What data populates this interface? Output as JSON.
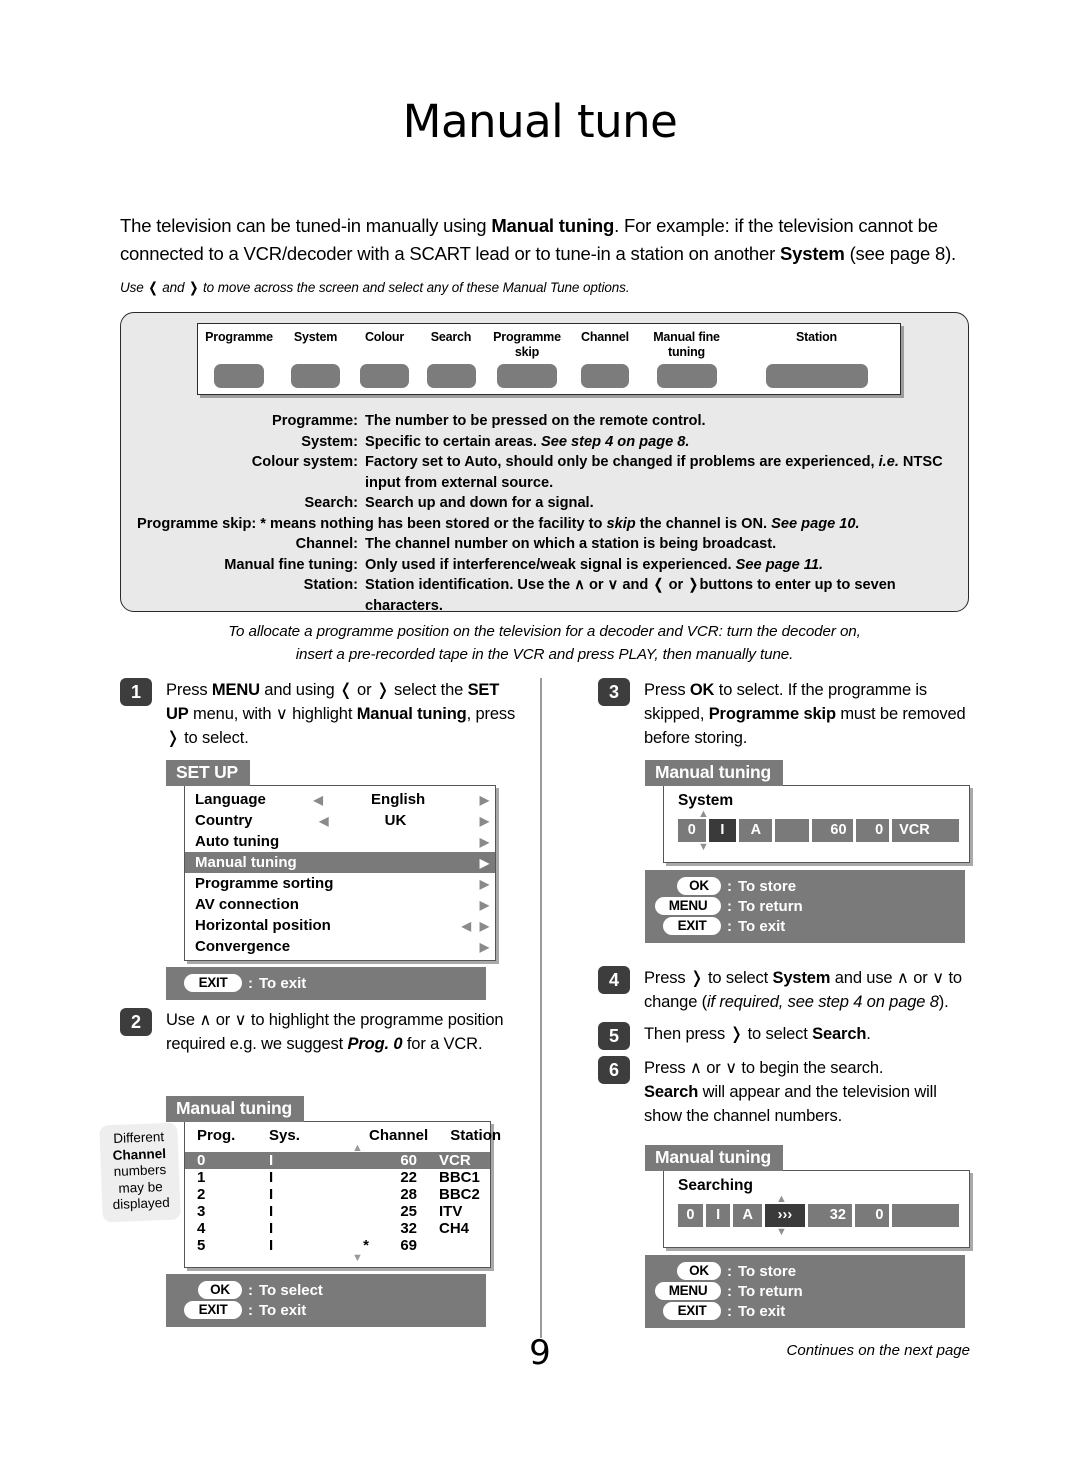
{
  "page": {
    "title": "Manual tune",
    "number": "9",
    "footer_note": "Continues on the next page"
  },
  "intro": {
    "line": "The television can be tuned-in manually using Manual tuning. For example: if the television cannot be connected to a VCR/decoder with a SCART lead or to tune-in a station on another System (see page 8).",
    "bold_1": "Manual tuning",
    "bold_2": "System",
    "use_note": "Use ‹ and › to move across the screen and select any of these Manual Tune options."
  },
  "option_bar": {
    "labels": [
      "Programme",
      "System",
      "Colour",
      "Search",
      "Programme\nskip",
      "Channel",
      "Manual fine\ntuning",
      "Station"
    ],
    "label_lines": [
      [
        "Programme",
        ""
      ],
      [
        "System",
        ""
      ],
      [
        "Colour",
        ""
      ],
      [
        "Search",
        ""
      ],
      [
        "Programme",
        "skip"
      ],
      [
        "Channel",
        ""
      ],
      [
        "Manual fine",
        "tuning"
      ],
      [
        "Station",
        ""
      ]
    ]
  },
  "definitions": [
    {
      "term": "Programme:",
      "desc": "The number to be pressed on the remote control."
    },
    {
      "term": "System:",
      "desc": "Specific to certain areas. See step 4 on page 8."
    },
    {
      "term": "Colour system:",
      "desc": "Factory set to Auto, should only be changed if problems are experienced, i.e. NTSC input from external source."
    },
    {
      "term": "Search:",
      "desc": "Search up and down for a signal."
    },
    {
      "term": "Programme skip:",
      "desc": "* means nothing has been stored or the facility to skip the channel is ON. See page 10."
    },
    {
      "term": "Channel:",
      "desc": "The channel number on which a station is being broadcast."
    },
    {
      "term": "Manual fine tuning:",
      "desc": "Only used if interference/weak signal is experienced. See page 11."
    },
    {
      "term": "Station:",
      "desc": "Station identification. Use the ∧ or ∨ and ‹ or › buttons to enter up to seven characters."
    }
  ],
  "allocate_note": {
    "line1": "To allocate a programme position on the television for a decoder and VCR: turn the decoder on,",
    "line2": "insert a pre-recorded tape in the VCR and press PLAY, then manually tune."
  },
  "steps": {
    "s1": {
      "num": "1",
      "text": "Press MENU and using ‹ or › select the SET UP menu, with ∨ highlight Manual tuning, press › to select."
    },
    "s2": {
      "num": "2",
      "text": "Use ∧ or ∨ to highlight the programme position required e.g. we suggest Prog. 0 for a VCR."
    },
    "s3": {
      "num": "3",
      "text": "Press OK to select. If the programme is skipped, Programme skip must be removed before storing."
    },
    "s4": {
      "num": "4",
      "text": "Press › to select System and use ∧ or ∨ to change (if required, see step 4 on page 8)."
    },
    "s5": {
      "num": "5",
      "text": "Then press › to select Search."
    },
    "s6": {
      "num": "6",
      "text": "Press ∧ or ∨ to begin the search. Search will appear and the television will show the channel numbers."
    }
  },
  "setup_menu": {
    "tab": "SET UP",
    "items": [
      {
        "label": "Language",
        "value": "English",
        "left_arrow": true,
        "right_arrow": true,
        "selected": false
      },
      {
        "label": "Country",
        "value": "UK",
        "left_arrow": true,
        "right_arrow": true,
        "selected": false
      },
      {
        "label": "Auto tuning",
        "value": "",
        "left_arrow": false,
        "right_arrow": true,
        "selected": false
      },
      {
        "label": "Manual tuning",
        "value": "",
        "left_arrow": false,
        "right_arrow": true,
        "selected": true
      },
      {
        "label": "Programme sorting",
        "value": "",
        "left_arrow": false,
        "right_arrow": true,
        "selected": false
      },
      {
        "label": "AV connection",
        "value": "",
        "left_arrow": false,
        "right_arrow": true,
        "selected": false
      },
      {
        "label": "Horizontal position",
        "value": "",
        "left_arrow": true,
        "right_arrow": true,
        "selected": false
      },
      {
        "label": "Convergence",
        "value": "",
        "left_arrow": false,
        "right_arrow": true,
        "selected": false
      }
    ],
    "footer": [
      {
        "key": "EXIT",
        "colon": ":",
        "action": "To exit"
      }
    ]
  },
  "manual_tuning_table": {
    "tab": "Manual tuning",
    "columns": [
      "Prog.",
      "Sys.",
      "Channel",
      "Station"
    ],
    "rows": [
      {
        "prog": "0",
        "sys": "I",
        "star": "",
        "channel": "60",
        "station": "VCR",
        "selected": true
      },
      {
        "prog": "1",
        "sys": "I",
        "star": "",
        "channel": "22",
        "station": "BBC1",
        "selected": false
      },
      {
        "prog": "2",
        "sys": "I",
        "star": "",
        "channel": "28",
        "station": "BBC2",
        "selected": false
      },
      {
        "prog": "3",
        "sys": "I",
        "star": "",
        "channel": "25",
        "station": "ITV",
        "selected": false
      },
      {
        "prog": "4",
        "sys": "I",
        "star": "",
        "channel": "32",
        "station": "CH4",
        "selected": false
      },
      {
        "prog": "5",
        "sys": "I",
        "star": "*",
        "channel": "69",
        "station": "",
        "selected": false
      }
    ],
    "footer": [
      {
        "key": "OK",
        "colon": ":",
        "action": "To select"
      },
      {
        "key": "EXIT",
        "colon": ":",
        "action": "To exit"
      }
    ]
  },
  "callout": {
    "l1": "Different",
    "l2": "Channel",
    "l3": "numbers",
    "l4": "may be",
    "l5": "displayed"
  },
  "system_osd": {
    "tab": "Manual tuning",
    "heading": "System",
    "fields": [
      "0",
      "I",
      "A",
      "",
      "60",
      "0",
      "VCR"
    ],
    "highlight_index": 1,
    "footer": [
      {
        "key": "OK",
        "colon": ":",
        "action": "To store"
      },
      {
        "key": "MENU",
        "colon": ":",
        "action": "To return"
      },
      {
        "key": "EXIT",
        "colon": ":",
        "action": "To exit"
      }
    ]
  },
  "searching_osd": {
    "tab": "Manual tuning",
    "heading": "Searching",
    "fields": [
      "0",
      "I",
      "A",
      "›››",
      "32",
      "0",
      ""
    ],
    "highlight_index": 3,
    "footer": [
      {
        "key": "OK",
        "colon": ":",
        "action": "To store"
      },
      {
        "key": "MENU",
        "colon": ":",
        "action": "To return"
      },
      {
        "key": "EXIT",
        "colon": ":",
        "action": "To exit"
      }
    ]
  },
  "colors": {
    "osd_grey": "#7a7a7a",
    "osd_dark": "#3a3a3a",
    "spec_box_bg": "#e9e9e9",
    "step_badge": "#3d3d3d"
  }
}
